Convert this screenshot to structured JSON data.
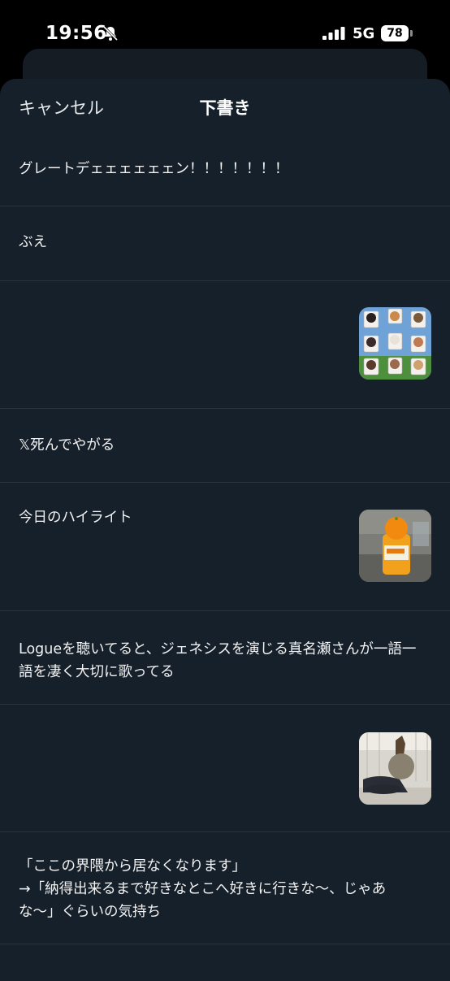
{
  "status_bar": {
    "time": "19:56",
    "network": "5G",
    "battery": "78"
  },
  "header": {
    "cancel_label": "キャンセル",
    "title": "下書き"
  },
  "drafts": [
    {
      "text": "グレートデェェェェェェン！！！！！！！"
    },
    {
      "text": "ぶえ"
    },
    {
      "text": "",
      "thumbnail": "character-grid-image"
    },
    {
      "text": "𝕏死んでやがる"
    },
    {
      "text": "今日のハイライト",
      "thumbnail": "orange-juice-bottle-photo"
    },
    {
      "text": "Logueを聴いてると、ジェネシスを演じる真名瀬さんが一語一語を凄く大切に歌ってる"
    },
    {
      "text": "",
      "thumbnail": "horse-mask-person-photo"
    },
    {
      "text": "「ここの界隈から居なくなります」\n→「納得出来るまで好きなとこへ好きに行きな〜、じゃあな〜」ぐらいの気持ち"
    }
  ],
  "colors": {
    "sheet_bg": "#16202a",
    "divider": "#2b343d",
    "text": "#f2f2f2"
  }
}
